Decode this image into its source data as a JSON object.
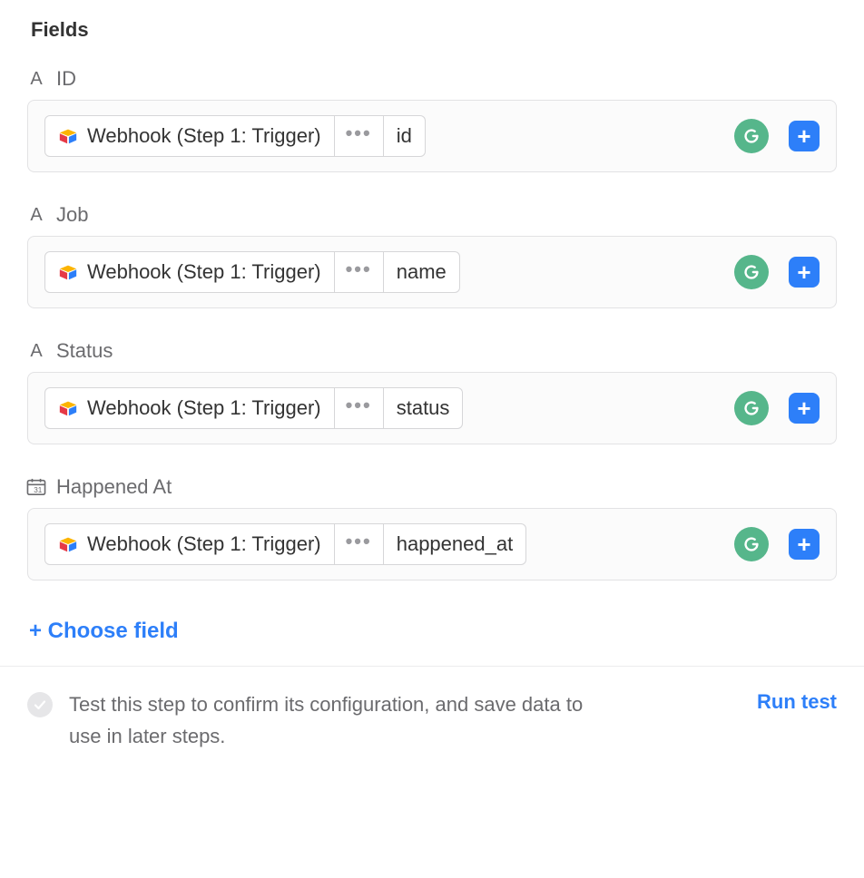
{
  "section_title": "Fields",
  "fields": [
    {
      "type": "text",
      "label": "ID",
      "source": "Webhook (Step 1: Trigger)",
      "path_value": "id"
    },
    {
      "type": "text",
      "label": "Job",
      "source": "Webhook (Step 1: Trigger)",
      "path_value": "name"
    },
    {
      "type": "text",
      "label": "Status",
      "source": "Webhook (Step 1: Trigger)",
      "path_value": "status"
    },
    {
      "type": "date",
      "label": "Happened At",
      "source": "Webhook (Step 1: Trigger)",
      "path_value": "happened_at"
    }
  ],
  "choose_field_label": "+ Choose field",
  "ellipsis": "•••",
  "test": {
    "description": "Test this step to confirm its configuration, and save data to use in later steps.",
    "run_label": "Run test"
  },
  "add_plus": "+",
  "type_glyph_text": "A"
}
